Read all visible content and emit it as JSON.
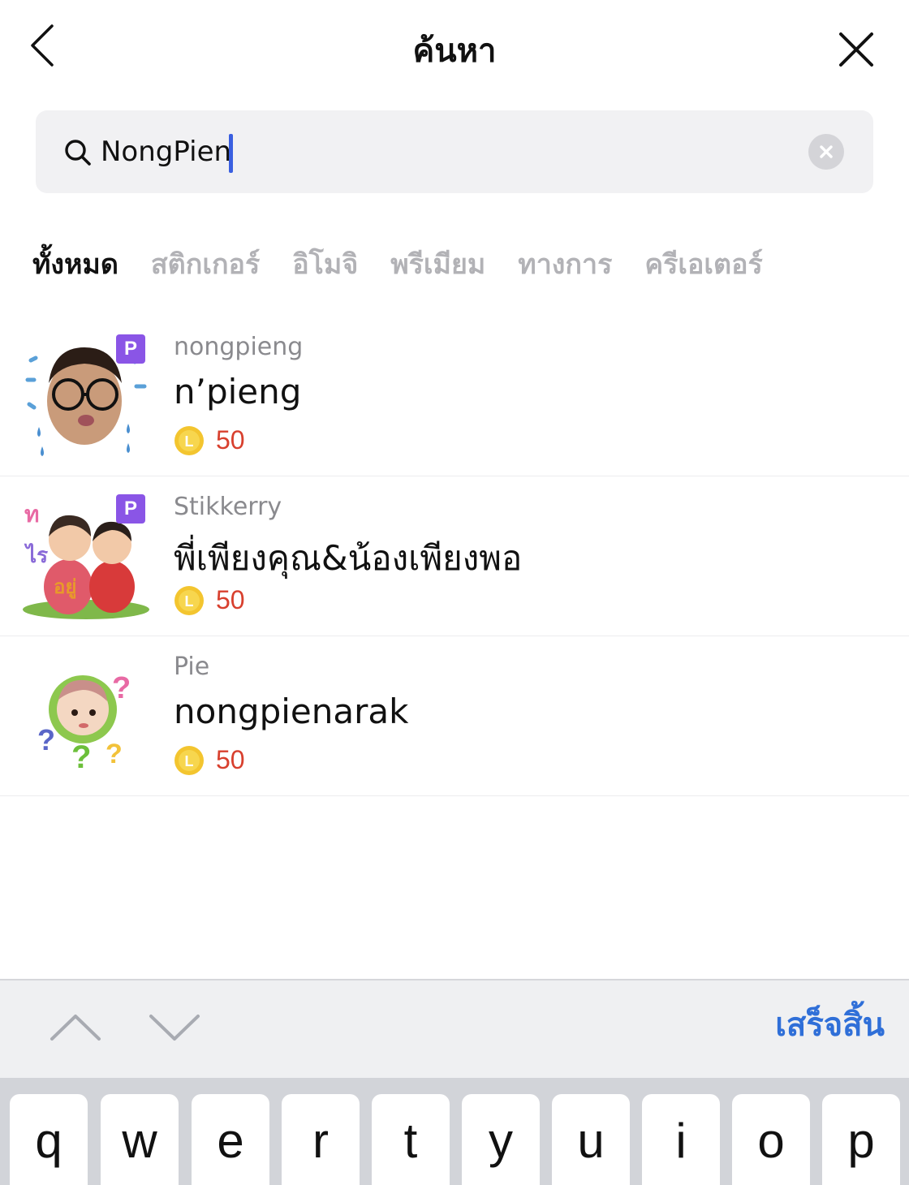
{
  "header": {
    "title": "ค้นหา",
    "back_icon": "chevron-left-icon",
    "close_icon": "close-icon"
  },
  "search": {
    "value": "NongPien",
    "icon": "search-icon",
    "clear_icon": "clear-icon"
  },
  "tabs": [
    {
      "label": "ทั้งหมด",
      "active": true
    },
    {
      "label": "สติกเกอร์",
      "active": false
    },
    {
      "label": "อิโมจิ",
      "active": false
    },
    {
      "label": "พรีเมียม",
      "active": false
    },
    {
      "label": "ทางการ",
      "active": false
    },
    {
      "label": "ครีเอเตอร์",
      "active": false
    }
  ],
  "results": [
    {
      "creator": "nongpieng",
      "name": "n’pieng",
      "price": "50",
      "premium_badge": "P"
    },
    {
      "creator": "Stikkerry",
      "name": "พี่เพียงคุณ&น้องเพียงพอ",
      "price": "50",
      "premium_badge": "P"
    },
    {
      "creator": "Pie",
      "name": "nongpienarak",
      "price": "50",
      "premium_badge": ""
    }
  ],
  "coin_letter": "L",
  "keyboard_toolbar": {
    "done_label": "เสร็จสิ้น",
    "prev_icon": "chevron-up-icon",
    "next_icon": "chevron-down-icon"
  },
  "keyboard": {
    "row1": [
      "q",
      "w",
      "e",
      "r",
      "t",
      "y",
      "u",
      "i",
      "o",
      "p"
    ]
  },
  "colors": {
    "accent": "#2f6fd8",
    "price": "#d8402e",
    "premium": "#8a55e6",
    "caret": "#3a5fe0"
  }
}
